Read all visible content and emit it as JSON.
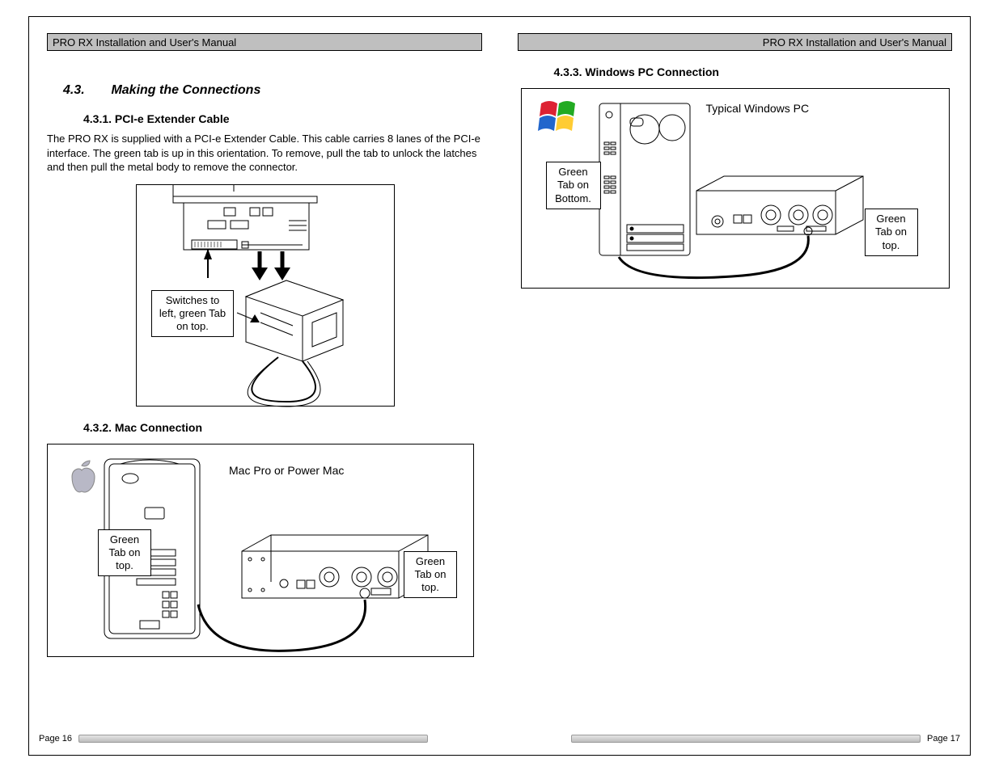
{
  "header": {
    "title": "PRO RX Installation and User's Manual"
  },
  "section": {
    "number": "4.3.",
    "title": "Making the Connections"
  },
  "sub431": {
    "heading": "4.3.1. PCI-e Extender Cable",
    "body": "The PRO RX is supplied with a PCI-e Extender Cable.  This cable carries 8 lanes of the PCI-e interface.  The green tab is up in this orientation.  To remove, pull the tab to unlock the latches and  then pull the metal body to remove the connector.",
    "callout": "Switches to left, green Tab on top."
  },
  "sub432": {
    "heading": "4.3.2. Mac Connection",
    "label": "Mac Pro or Power Mac",
    "callout_left": "Green Tab on top.",
    "callout_right": "Green Tab on top."
  },
  "sub433": {
    "heading": "4.3.3. Windows PC Connection",
    "label": "Typical Windows PC",
    "callout_left": "Green Tab on Bottom.",
    "callout_right": "Green Tab on top."
  },
  "footer": {
    "left": "Page 16",
    "right": "Page 17"
  }
}
